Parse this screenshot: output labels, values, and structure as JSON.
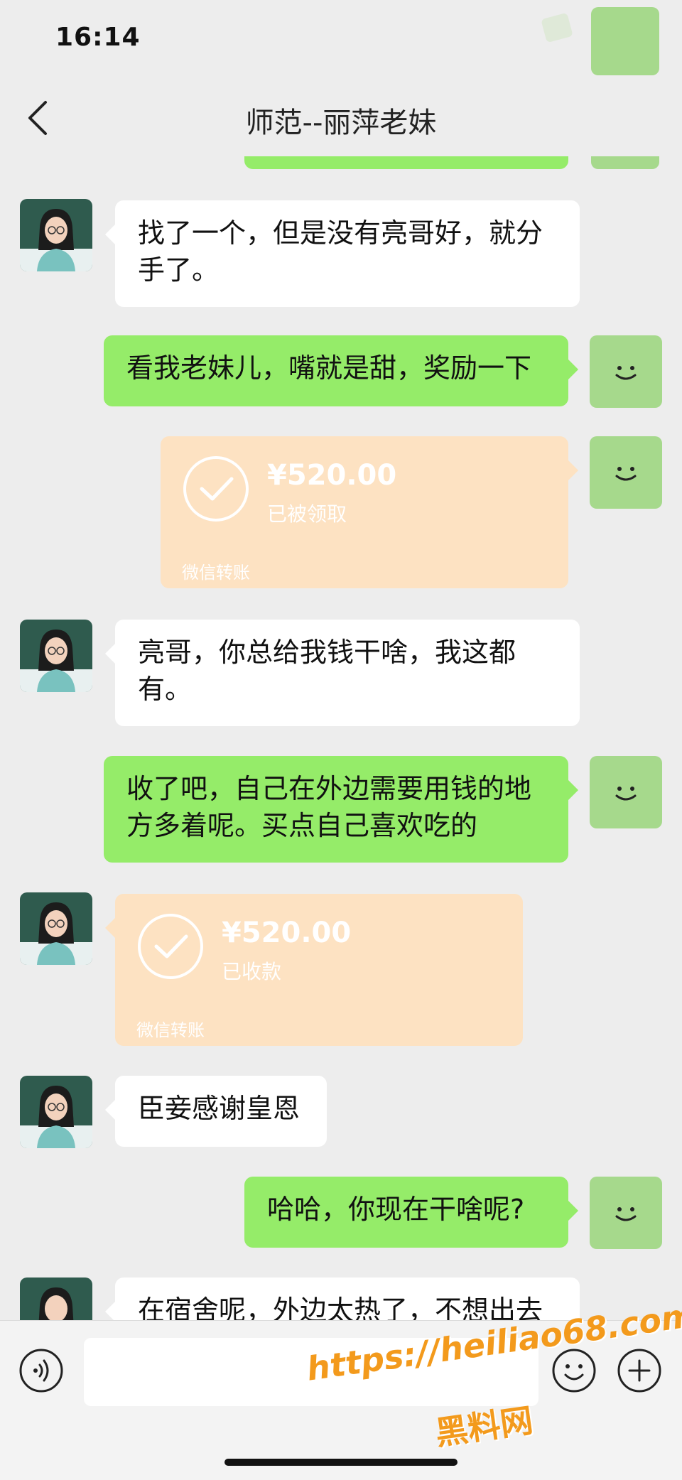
{
  "status_bar": {
    "time": "16:14"
  },
  "header": {
    "title": "师范--丽萍老妹"
  },
  "messages": [
    {
      "text": "找了一个，但是没有亮哥好，就分手了。"
    },
    {
      "text": "看我老妹儿，嘴就是甜，奖励一下"
    },
    {
      "amount": "¥520.00",
      "status": "已被领取",
      "label": "微信转账"
    },
    {
      "text": "亮哥，你总给我钱干啥，我这都有。"
    },
    {
      "text": "收了吧，自己在外边需要用钱的地方多着呢。买点自己喜欢吃的"
    },
    {
      "amount": "¥520.00",
      "status": "已收款",
      "label": "微信转账"
    },
    {
      "text": "臣妾感谢皇恩"
    },
    {
      "text": "哈哈，你现在干啥呢?"
    },
    {
      "text": "在宿舍呢，外边太热了，不想出去"
    }
  ],
  "input": {
    "placeholder": ""
  },
  "watermark": {
    "url": "https://heiliao68.com",
    "name": "黑料网"
  },
  "colors": {
    "outgoing": "#95ec69",
    "incoming": "#ffffff",
    "transfer": "#fde2c2",
    "background": "#ededed"
  }
}
